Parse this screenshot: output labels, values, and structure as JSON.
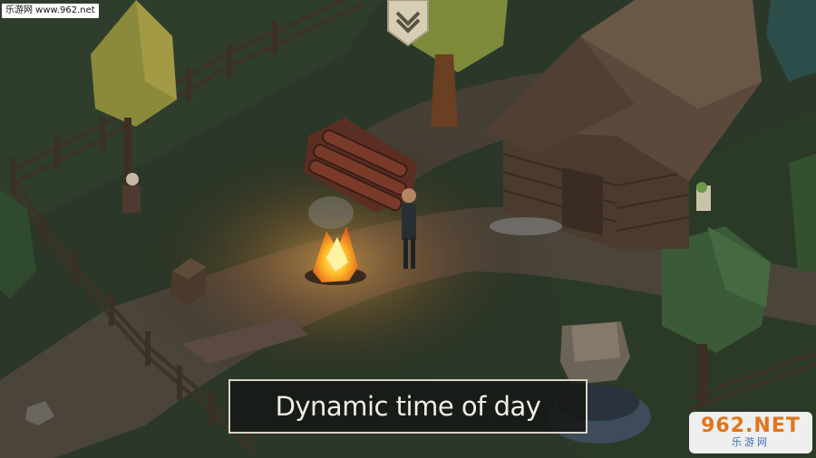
{
  "watermark": {
    "text": "乐游网 www.962.net"
  },
  "caption": {
    "text": "Dynamic time of day"
  },
  "logo": {
    "main": "962.NET",
    "sub": "乐游网"
  },
  "menu": {
    "icon": "chevron-down-icon"
  },
  "colors": {
    "ground": "#2e3b2c",
    "path": "#4a443a",
    "fire": "#f7a21b",
    "frame": "#d8d4c6"
  }
}
